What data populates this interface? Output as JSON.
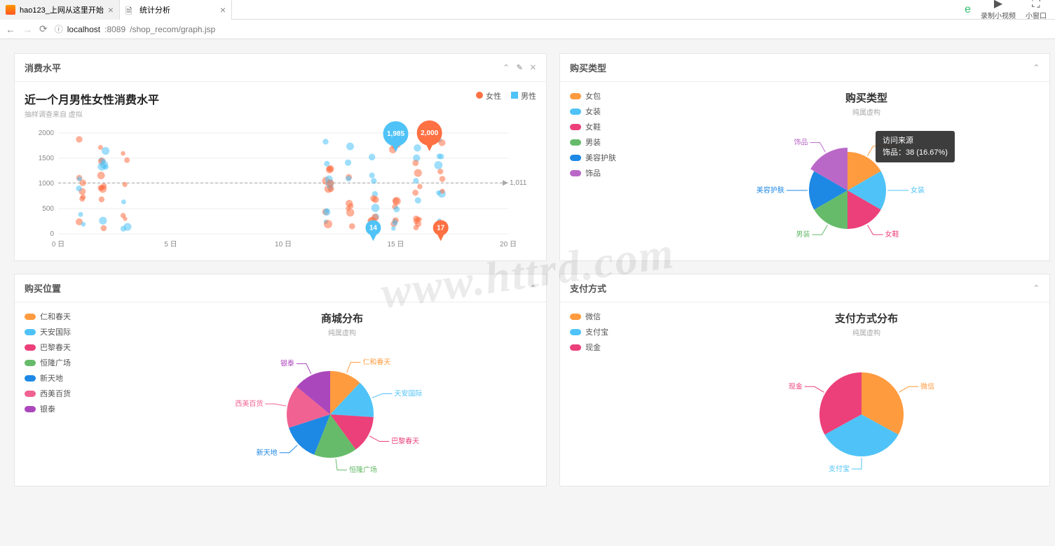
{
  "browser": {
    "tabs": [
      {
        "label": "hao123_上网从这里开始",
        "active": false
      },
      {
        "label": "统计分析",
        "active": true
      }
    ],
    "rightButtons": [
      {
        "icon": "e",
        "label": "",
        "green": true
      },
      {
        "icon": "⏺",
        "label": "录制小视频"
      },
      {
        "icon": "⌵",
        "label": "小窗口"
      }
    ],
    "url_host": "localhost",
    "url_port": ":8089",
    "url_path": "/shop_recom/graph.jsp"
  },
  "watermark": "www.httrd.com",
  "panel1": {
    "headTitle": "消费水平",
    "chartTitle": "近一个月男性女性消费水平",
    "chartSub": "抽样调查来自 虚拟",
    "legend": [
      {
        "label": "女性",
        "color": "#ff7043"
      },
      {
        "label": "男性",
        "color": "#4fc3f7"
      }
    ],
    "markLineLabel": "1,011",
    "bubbles": [
      {
        "day": 15,
        "value": 1985,
        "color": "#4fc3f7",
        "text": "1,985"
      },
      {
        "day": 16.5,
        "value": 2000,
        "color": "#ff7043",
        "text": "2,000"
      },
      {
        "day": 14,
        "value": 120,
        "color": "#4fc3f7",
        "text": "14",
        "small": true
      },
      {
        "day": 17,
        "value": 120,
        "color": "#ff7043",
        "text": "17",
        "small": true
      }
    ]
  },
  "panel2": {
    "headTitle": "购买类型",
    "chartTitle": "购买类型",
    "chartSub": "纯属虚构",
    "tooltip": {
      "title": "访问来源",
      "line": "饰品：38 (16.67%)"
    }
  },
  "panel3": {
    "headTitle": "购买位置",
    "chartTitle": "商城分布",
    "chartSub": "纯属虚构"
  },
  "panel4": {
    "headTitle": "支付方式",
    "chartTitle": "支付方式分布",
    "chartSub": "纯属虚构"
  },
  "chart_data": [
    {
      "id": "consumption_scatter",
      "type": "scatter",
      "title": "近一个月男性女性消费水平",
      "xlabel": "日",
      "ylabel": "",
      "xlim": [
        0,
        20
      ],
      "ylim": [
        0,
        2000
      ],
      "xticks": [
        "0 日",
        "5 日",
        "10 日",
        "15 日",
        "20 日"
      ],
      "yticks": [
        0,
        500,
        1000,
        1500,
        2000
      ],
      "markline_y": 1011,
      "series": [
        {
          "name": "女性",
          "color": "#ff7043"
        },
        {
          "name": "男性",
          "color": "#4fc3f7"
        }
      ],
      "highlights": [
        {
          "series": "男性",
          "x": 15,
          "y": 1985
        },
        {
          "series": "女性",
          "x": 16.5,
          "y": 2000
        },
        {
          "series": "男性",
          "x": 14,
          "y_label": 14
        },
        {
          "series": "女性",
          "x": 17,
          "y_label": 17
        }
      ]
    },
    {
      "id": "purchase_type_pie",
      "type": "pie",
      "title": "购买类型",
      "categories": [
        "女包",
        "女装",
        "女鞋",
        "男装",
        "美容护肤",
        "饰品"
      ],
      "values": [
        38,
        38,
        38,
        38,
        38,
        38
      ],
      "percentages": [
        16.67,
        16.67,
        16.67,
        16.67,
        16.67,
        16.67
      ],
      "colors": [
        "#ff9b3f",
        "#4fc3f7",
        "#ec407a",
        "#66bb6a",
        "#1e88e5",
        "#ba68c8"
      ],
      "tooltip": {
        "label": "饰品",
        "value": 38,
        "percent": 16.67,
        "source": "访问来源"
      }
    },
    {
      "id": "mall_distribution_pie",
      "type": "pie",
      "title": "商城分布",
      "categories": [
        "仁和春天",
        "天安国际",
        "巴黎春天",
        "恒隆广场",
        "新天地",
        "西美百货",
        "银泰"
      ],
      "values": [
        12,
        14,
        14,
        16,
        14,
        16,
        14
      ],
      "colors": [
        "#ff9b3f",
        "#4fc3f7",
        "#ec407a",
        "#66bb6a",
        "#1e88e5",
        "#f06292",
        "#ab47bc"
      ]
    },
    {
      "id": "payment_pie",
      "type": "pie",
      "title": "支付方式分布",
      "categories": [
        "微信",
        "支付宝",
        "现金"
      ],
      "values": [
        33,
        34,
        33
      ],
      "colors": [
        "#ff9b3f",
        "#4fc3f7",
        "#ec407a"
      ]
    }
  ]
}
